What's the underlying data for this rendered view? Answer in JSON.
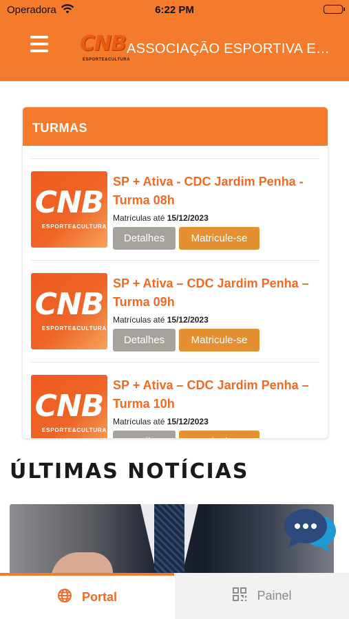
{
  "status_bar": {
    "carrier": "Operadora",
    "time": "6:22 PM"
  },
  "header": {
    "logo_text": "CNB",
    "logo_subtext": "ESPORTE&CULTURA",
    "title": "ASSOCIAÇÃO ESPORTIVA E CULTURAL NOVA BRASÍLIA"
  },
  "turmas": {
    "heading": "TURMAS",
    "items": [
      {
        "title": "SP + Ativa - CDC Jardim Penha - Turma 08h",
        "date_label": "Matrículas até",
        "date": "15/12/2023",
        "thumb_text": "CNB",
        "thumb_sub": "ESPORTE&CULTURA",
        "details_label": "Detalhes",
        "enroll_label": "Matricule-se"
      },
      {
        "title": "SP + Ativa – CDC Jardim Penha – Turma 09h",
        "date_label": "Matrículas até",
        "date": "15/12/2023",
        "thumb_text": "CNB",
        "thumb_sub": "ESPORTE&CULTURA",
        "details_label": "Detalhes",
        "enroll_label": "Matricule-se"
      },
      {
        "title": "SP + Ativa – CDC Jardim Penha – Turma 10h",
        "date_label": "Matrículas até",
        "date": "15/12/2023",
        "thumb_text": "CNB",
        "thumb_sub": "ESPORTE&CULTURA",
        "details_label": "Detalhes",
        "enroll_label": "Matricule-se"
      }
    ]
  },
  "news": {
    "heading": "ÚLTIMAS NOTÍCIAS"
  },
  "tabs": [
    {
      "label": "Portal",
      "icon": "globe-icon",
      "active": true
    },
    {
      "label": "Painel",
      "icon": "dashboard-grid-icon",
      "active": false
    }
  ],
  "colors": {
    "brand": "#f47a2c",
    "accent_text": "#ef6a25",
    "enroll_button": "#e48f31",
    "details_button": "#a6a39d"
  }
}
